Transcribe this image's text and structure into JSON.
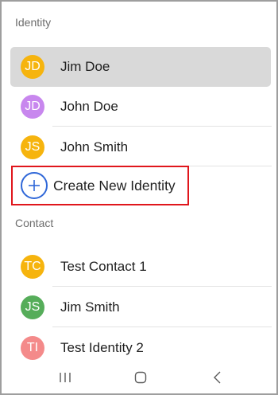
{
  "sections": {
    "identity_label": "Identity",
    "contact_label": "Contact"
  },
  "identities": [
    {
      "initials": "JD",
      "name": "Jim Doe",
      "color": "#f6b40e",
      "selected": true
    },
    {
      "initials": "JD",
      "name": "John Doe",
      "color": "#c887ee",
      "selected": false
    },
    {
      "initials": "JS",
      "name": "John Smith",
      "color": "#f6b40e",
      "selected": false
    }
  ],
  "create_identity": {
    "label": "Create New Identity",
    "icon": "plus-icon",
    "accent": "#2f67d8",
    "highlight": "#e0161c"
  },
  "contacts": [
    {
      "initials": "TC",
      "name": "Test Contact 1",
      "color": "#f6b40e"
    },
    {
      "initials": "JS",
      "name": "Jim Smith",
      "color": "#56ad5a"
    },
    {
      "initials": "TI",
      "name": "Test Identity 2",
      "color": "#f48a8a"
    }
  ],
  "nav": {
    "recents_icon": "recents-icon",
    "home_icon": "home-icon",
    "back_icon": "back-icon"
  }
}
